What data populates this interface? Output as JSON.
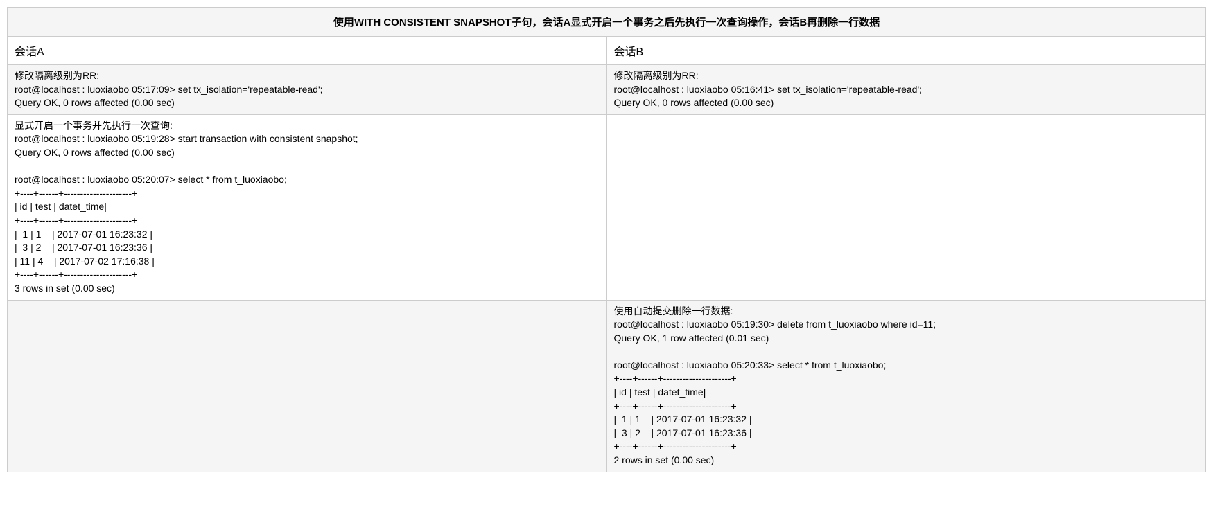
{
  "title": "使用WITH CONSISTENT SNAPSHOT子句，会话A显式开启一个事务之后先执行一次查询操作，会话B再删除一行数据",
  "headers": {
    "colA": "会话A",
    "colB": "会话B"
  },
  "rows": [
    {
      "a": "修改隔离级别为RR:\nroot@localhost : luoxiaobo 05:17:09> set tx_isolation='repeatable-read';\nQuery OK, 0 rows affected (0.00 sec)",
      "b": "修改隔离级别为RR:\nroot@localhost : luoxiaobo 05:16:41> set tx_isolation='repeatable-read';\nQuery OK, 0 rows affected (0.00 sec)",
      "bg": "gray"
    },
    {
      "a": "显式开启一个事务并先执行一次查询:\nroot@localhost : luoxiaobo 05:19:28> start transaction with consistent snapshot;\nQuery OK, 0 rows affected (0.00 sec)\n\nroot@localhost : luoxiaobo 05:20:07> select * from t_luoxiaobo;\n+----+------+---------------------+\n| id | test | datet_time|\n+----+------+---------------------+\n|  1 | 1    | 2017-07-01 16:23:32 |\n|  3 | 2    | 2017-07-01 16:23:36 |\n| 11 | 4    | 2017-07-02 17:16:38 |\n+----+------+---------------------+\n3 rows in set (0.00 sec)",
      "b": "",
      "bg": "white"
    },
    {
      "a": "",
      "b": "使用自动提交删除一行数据:\nroot@localhost : luoxiaobo 05:19:30> delete from t_luoxiaobo where id=11;\nQuery OK, 1 row affected (0.01 sec)\n\nroot@localhost : luoxiaobo 05:20:33> select * from t_luoxiaobo;\n+----+------+---------------------+\n| id | test | datet_time|\n+----+------+---------------------+\n|  1 | 1    | 2017-07-01 16:23:32 |\n|  3 | 2    | 2017-07-01 16:23:36 |\n+----+------+---------------------+\n2 rows in set (0.00 sec)",
      "bg": "gray"
    }
  ]
}
